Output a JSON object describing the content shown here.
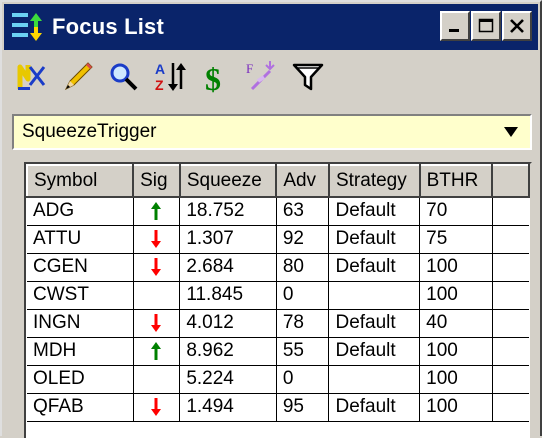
{
  "window": {
    "title": "Focus List"
  },
  "toolbar": {
    "buttons": [
      {
        "icon": "new-list-icon"
      },
      {
        "icon": "pencil-edit-icon"
      },
      {
        "icon": "magnifier-icon"
      },
      {
        "icon": "sort-az-icon"
      },
      {
        "icon": "dollar-icon"
      },
      {
        "icon": "formula-wand-icon"
      },
      {
        "icon": "funnel-filter-icon"
      }
    ]
  },
  "list_selector": {
    "value": "SqueezeTrigger"
  },
  "grid": {
    "columns": [
      "Symbol",
      "Sig",
      "Squeeze",
      "Adv",
      "Strategy",
      "BTHR"
    ],
    "rows": [
      {
        "symbol": "ADG",
        "sig": "up",
        "squeeze": "18.752",
        "adv": "63",
        "strategy": "Default",
        "bthr": "70"
      },
      {
        "symbol": "ATTU",
        "sig": "down",
        "squeeze": "1.307",
        "adv": "92",
        "strategy": "Default",
        "bthr": "75"
      },
      {
        "symbol": "CGEN",
        "sig": "down",
        "squeeze": "2.684",
        "adv": "80",
        "strategy": "Default",
        "bthr": "100"
      },
      {
        "symbol": "CWST",
        "sig": "",
        "squeeze": "11.845",
        "adv": "0",
        "strategy": "",
        "bthr": "100"
      },
      {
        "symbol": "INGN",
        "sig": "down",
        "squeeze": "4.012",
        "adv": "78",
        "strategy": "Default",
        "bthr": "40"
      },
      {
        "symbol": "MDH",
        "sig": "up",
        "squeeze": "8.962",
        "adv": "55",
        "strategy": "Default",
        "bthr": "100"
      },
      {
        "symbol": "OLED",
        "sig": "",
        "squeeze": "5.224",
        "adv": "0",
        "strategy": "",
        "bthr": "100"
      },
      {
        "symbol": "QFAB",
        "sig": "down",
        "squeeze": "1.494",
        "adv": "95",
        "strategy": "Default",
        "bthr": "100"
      }
    ]
  },
  "colors": {
    "titlebar": "#0a246a",
    "selector_bg": "#ffffcc",
    "up_arrow": "#008000",
    "down_arrow": "#ff0000",
    "chrome": "#d4d0c8"
  }
}
